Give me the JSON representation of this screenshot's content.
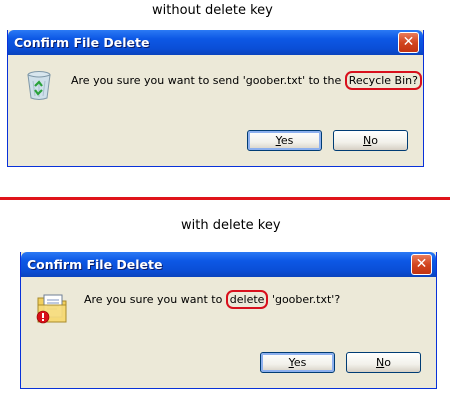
{
  "captions": {
    "top": "without delete key",
    "bottom": "with delete key"
  },
  "dialog1": {
    "title": "Confirm File Delete",
    "close_glyph": "✕",
    "icon": "recycle-bin-icon",
    "message_before": "Are you sure you want to send 'goober.txt' to the ",
    "message_highlight": "Recycle Bin?",
    "yes_mnemonic": "Y",
    "yes_rest": "es",
    "no_mnemonic": "N",
    "no_rest": "o"
  },
  "dialog2": {
    "title": "Confirm File Delete",
    "close_glyph": "✕",
    "icon": "delete-file-icon",
    "message_before": "Are you sure you want to ",
    "message_highlight": "delete",
    "message_after": " 'goober.txt'?",
    "yes_mnemonic": "Y",
    "yes_rest": "es",
    "no_mnemonic": "N",
    "no_rest": "o"
  },
  "colors": {
    "highlight_outline": "#d8101c",
    "separator": "#e0141a",
    "titlebar": "#0a4ed6",
    "dialog_face": "#ece9d8"
  }
}
